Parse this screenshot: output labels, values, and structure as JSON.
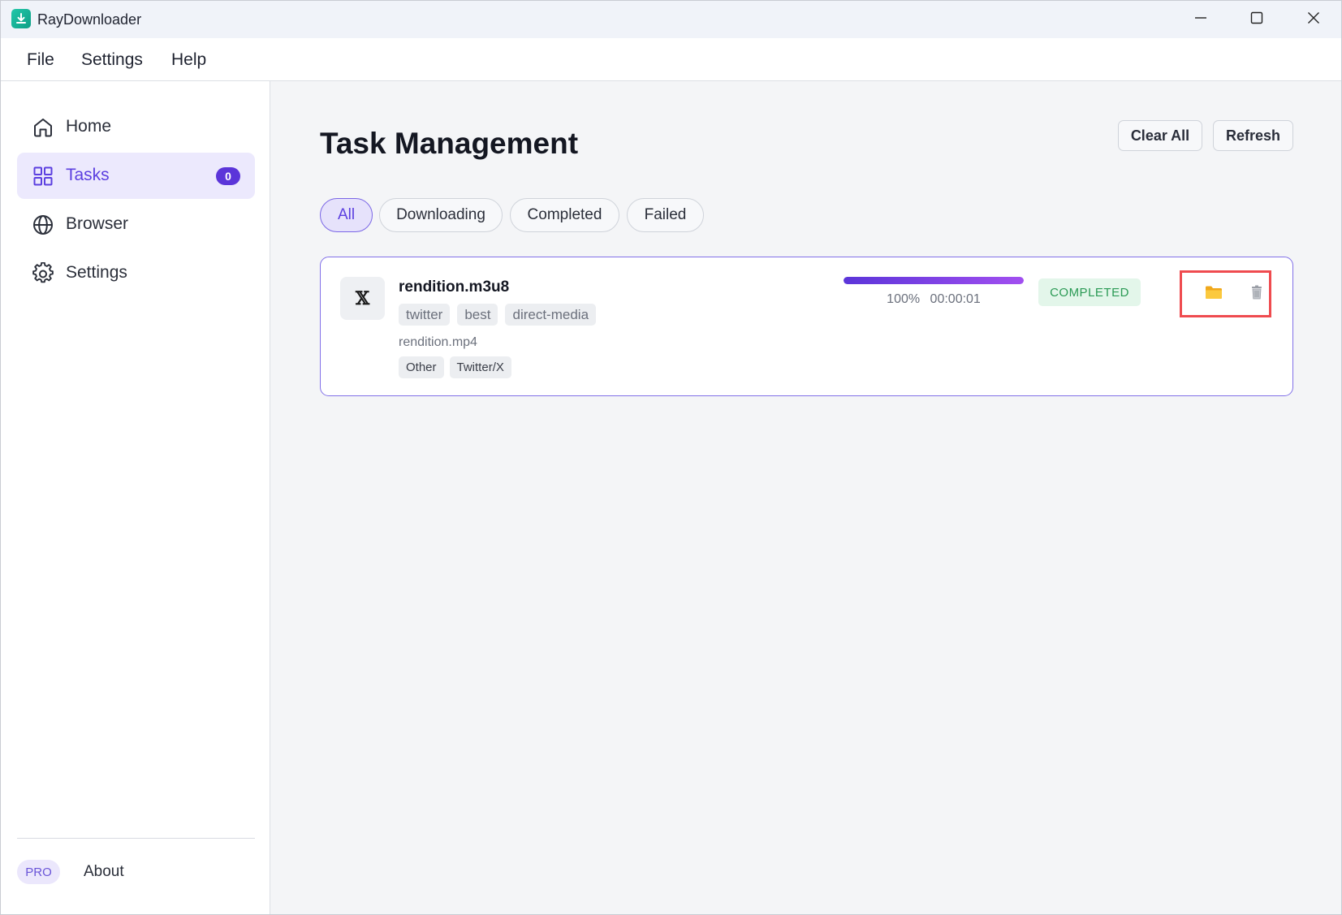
{
  "window": {
    "title": "RayDownloader",
    "icons": {
      "app": "download-app-icon",
      "minimize": "minimize-icon",
      "maximize": "maximize-icon",
      "close": "close-icon"
    }
  },
  "menu": {
    "items": [
      {
        "label": "File"
      },
      {
        "label": "Settings"
      },
      {
        "label": "Help"
      }
    ]
  },
  "sidebar": {
    "items": [
      {
        "label": "Home",
        "icon": "home-icon"
      },
      {
        "label": "Tasks",
        "icon": "grid-icon",
        "badge": "0",
        "active": true
      },
      {
        "label": "Browser",
        "icon": "globe-icon"
      },
      {
        "label": "Settings",
        "icon": "gear-icon"
      }
    ],
    "pro_label": "PRO",
    "about_label": "About"
  },
  "main": {
    "title": "Task Management",
    "buttons": {
      "clear_all": "Clear All",
      "refresh": "Refresh"
    },
    "filters": [
      {
        "label": "All",
        "active": true
      },
      {
        "label": "Downloading"
      },
      {
        "label": "Completed"
      },
      {
        "label": "Failed"
      }
    ],
    "tasks": [
      {
        "site_glyph": "𝕏",
        "name": "rendition.m3u8",
        "tags": [
          "twitter",
          "best",
          "direct-media"
        ],
        "filename": "rendition.mp4",
        "meta": [
          "Other",
          "Twitter/X"
        ],
        "progress_percent": 100,
        "progress_label": "100%",
        "elapsed": "00:00:01",
        "status": "COMPLETED",
        "actions": {
          "open_folder_icon": "folder-icon",
          "delete_icon": "trash-icon"
        }
      }
    ]
  },
  "colors": {
    "accent": "#5b35d9",
    "active_bg": "#ece9fd",
    "status_completed_bg": "#e3f6ea",
    "status_completed_text": "#2b9a55",
    "highlight_box": "#ef4b4f",
    "folder": "#f5b828"
  }
}
